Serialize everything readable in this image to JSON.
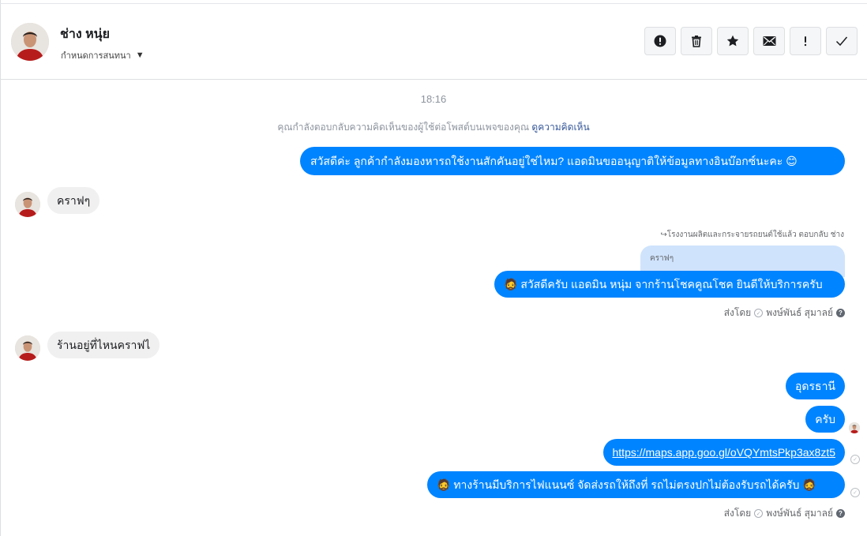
{
  "header": {
    "name": "ช่าง หนุ่ย",
    "assign_label": "กำหนดการสนทนา",
    "toolbar": [
      {
        "icon": "exclamation-circle-icon"
      },
      {
        "icon": "trash-icon"
      },
      {
        "icon": "star-icon"
      },
      {
        "icon": "envelope-icon"
      },
      {
        "icon": "exclamation-icon"
      },
      {
        "icon": "checkmark-icon"
      }
    ]
  },
  "conversation": {
    "time": "18:16",
    "notice_text": "คุณกำลังตอบกลับความคิดเห็นของผู้ใช้ต่อโพสต์บนเพจของคุณ",
    "notice_link": "ดูความคิดเห็น",
    "messages": [
      {
        "from": "page",
        "text": "สวัสดีค่ะ ลูกค้ากำลังมองหารถใช้งานสักคันอยู่ใช่ไหม? แอดมินขออนุญาติให้ข้อมูลทางอินบ๊อกซ์นะคะ 😊"
      },
      {
        "from": "user",
        "text": "คราฟๆ"
      },
      {
        "from": "page",
        "reply_header": "โรงงานผลิตและกระจายรถยนต์ใช้แล้ว ตอบกลับ ช่าง",
        "quoted": "คราฟๆ",
        "emoji": "🧔",
        "text": "สวัสดีครับ แอดมิน หนุ่ม จากร้านโชคคูณโชค ยินดีให้บริการครับ"
      },
      {
        "from": "user",
        "text": "ร้านอยู่ที่ไหนคราฟไ"
      },
      {
        "from": "page",
        "text": "อุดรธานี"
      },
      {
        "from": "page",
        "text": "ครับ"
      },
      {
        "from": "page",
        "text": "https://maps.app.goo.gl/oVQYmtsPkp3ax8zt5"
      },
      {
        "from": "page",
        "emoji": "🧔",
        "text": "ทางร้านมีบริการไฟแนนซ์ จัดส่งรถให้ถึงที่ รถไม่ตรงปกไม่ต้องรับรถได้ครับ",
        "emoji_end": "🧔"
      }
    ],
    "sent_by_label": "ส่งโดย",
    "sender_name": "พงษ์พันธ์ สุมาลย์"
  },
  "colors": {
    "outgoing_bubble": "#0084ff",
    "incoming_bubble": "#f1f0f0",
    "quoted_bubble": "#cfe3fc",
    "link": "#365899"
  }
}
